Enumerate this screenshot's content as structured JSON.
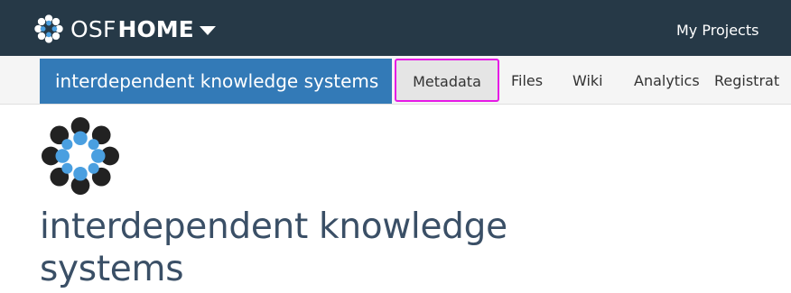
{
  "topbar": {
    "brand_osf": "OSF",
    "brand_home": "HOME",
    "my_projects": "My Projects",
    "logo_icon": "osf-logo-icon",
    "caret_icon": "caret-down-icon"
  },
  "project_nav": {
    "project_title": "interdependent knowledge systems",
    "items": [
      {
        "label": "Metadata",
        "active_highlight": true
      },
      {
        "label": "Files"
      },
      {
        "label": "Wiki"
      },
      {
        "label": "Analytics"
      },
      {
        "label": "Registrat"
      }
    ]
  },
  "main": {
    "logo_icon": "osf-logo-icon",
    "page_title": "interdependent knowledge systems"
  },
  "colors": {
    "topbar_bg": "#263947",
    "project_title_bg": "#337ab7",
    "highlight_border": "#e619e6",
    "logo_blue": "#4a9fe0",
    "logo_dark": "#222222",
    "title_text": "#3a4f66"
  }
}
